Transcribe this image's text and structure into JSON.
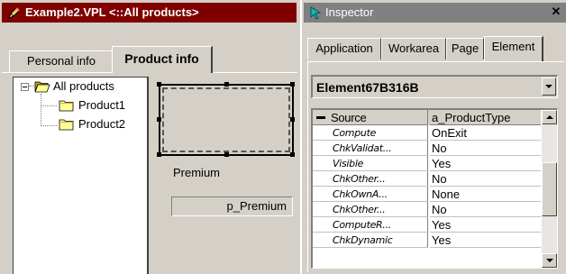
{
  "left_window": {
    "title": "Example2.VPL <::All products>",
    "title_icon": "pencil-icon",
    "tabs": [
      {
        "label": "Personal info",
        "active": false
      },
      {
        "label": "Product info",
        "active": true
      }
    ],
    "tree": {
      "root": {
        "label": "All products",
        "icon": "folder-open-icon",
        "expanded": true
      },
      "children": [
        {
          "label": "Product1",
          "icon": "folder-icon"
        },
        {
          "label": "Product2",
          "icon": "folder-icon"
        }
      ]
    },
    "premium_label": "Premium",
    "premium_field_value": "p_Premium"
  },
  "inspector": {
    "title": "Inspector",
    "title_icon": "inspector-icon",
    "close_icon": "close-icon",
    "tabs": [
      {
        "label": "Application",
        "active": false
      },
      {
        "label": "Workarea",
        "active": false
      },
      {
        "label": "Page",
        "active": false
      },
      {
        "label": "Element",
        "active": true
      }
    ],
    "element_selector": "Element67B316B",
    "grid": {
      "header": {
        "name": "Source",
        "value": "a_ProductType",
        "expanded": true
      },
      "rows": [
        {
          "name": "Compute",
          "value": "OnExit"
        },
        {
          "name": "ChkValidat...",
          "value": "No"
        },
        {
          "name": "Visible",
          "value": "Yes"
        },
        {
          "name": "ChkOther...",
          "value": "No"
        },
        {
          "name": "ChkOwnA...",
          "value": "None"
        },
        {
          "name": "ChkOther...",
          "value": "No"
        },
        {
          "name": "ComputeR...",
          "value": "Yes"
        },
        {
          "name": "ChkDynamic",
          "value": "Yes"
        }
      ]
    }
  },
  "colors": {
    "window_bg": "#d4d0c8",
    "active_title": "#800000",
    "inactive_title": "#808080",
    "folder_yellow": "#ffff99"
  }
}
